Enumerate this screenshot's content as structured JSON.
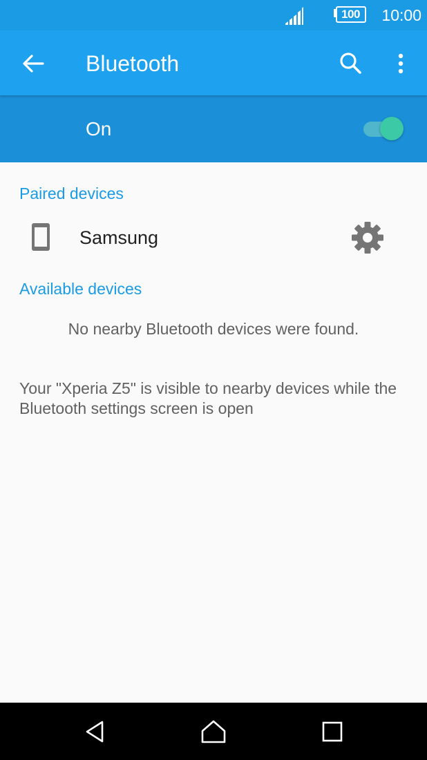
{
  "status_bar": {
    "battery": "100",
    "time": "10:00",
    "signal_icon": "cell-signal-icon",
    "battery_icon": "battery-icon"
  },
  "app_bar": {
    "title": "Bluetooth",
    "back_icon": "arrow-back-icon",
    "search_icon": "search-icon",
    "more_icon": "more-vert-icon"
  },
  "master_switch": {
    "label": "On",
    "state": true
  },
  "paired_devices": {
    "header": "Paired devices",
    "items": [
      {
        "name": "Samsung",
        "icon": "smartphone-icon",
        "action_icon": "gear-icon"
      }
    ]
  },
  "available_devices": {
    "header": "Available devices",
    "empty_message": "No nearby Bluetooth devices were found."
  },
  "visibility_note": "Your \"Xperia Z5\" is visible to nearby devices while the Bluetooth settings screen is open",
  "nav_bar": {
    "back_icon": "nav-back-icon",
    "home_icon": "nav-home-icon",
    "recents_icon": "nav-recents-icon"
  },
  "colors": {
    "status_bar": "#1a9be4",
    "app_bar": "#1ea1ee",
    "switch_bar": "#1b8fd8",
    "accent": "#1a9be4",
    "toggle_thumb": "#3bc9a6",
    "background": "#fafafa"
  }
}
